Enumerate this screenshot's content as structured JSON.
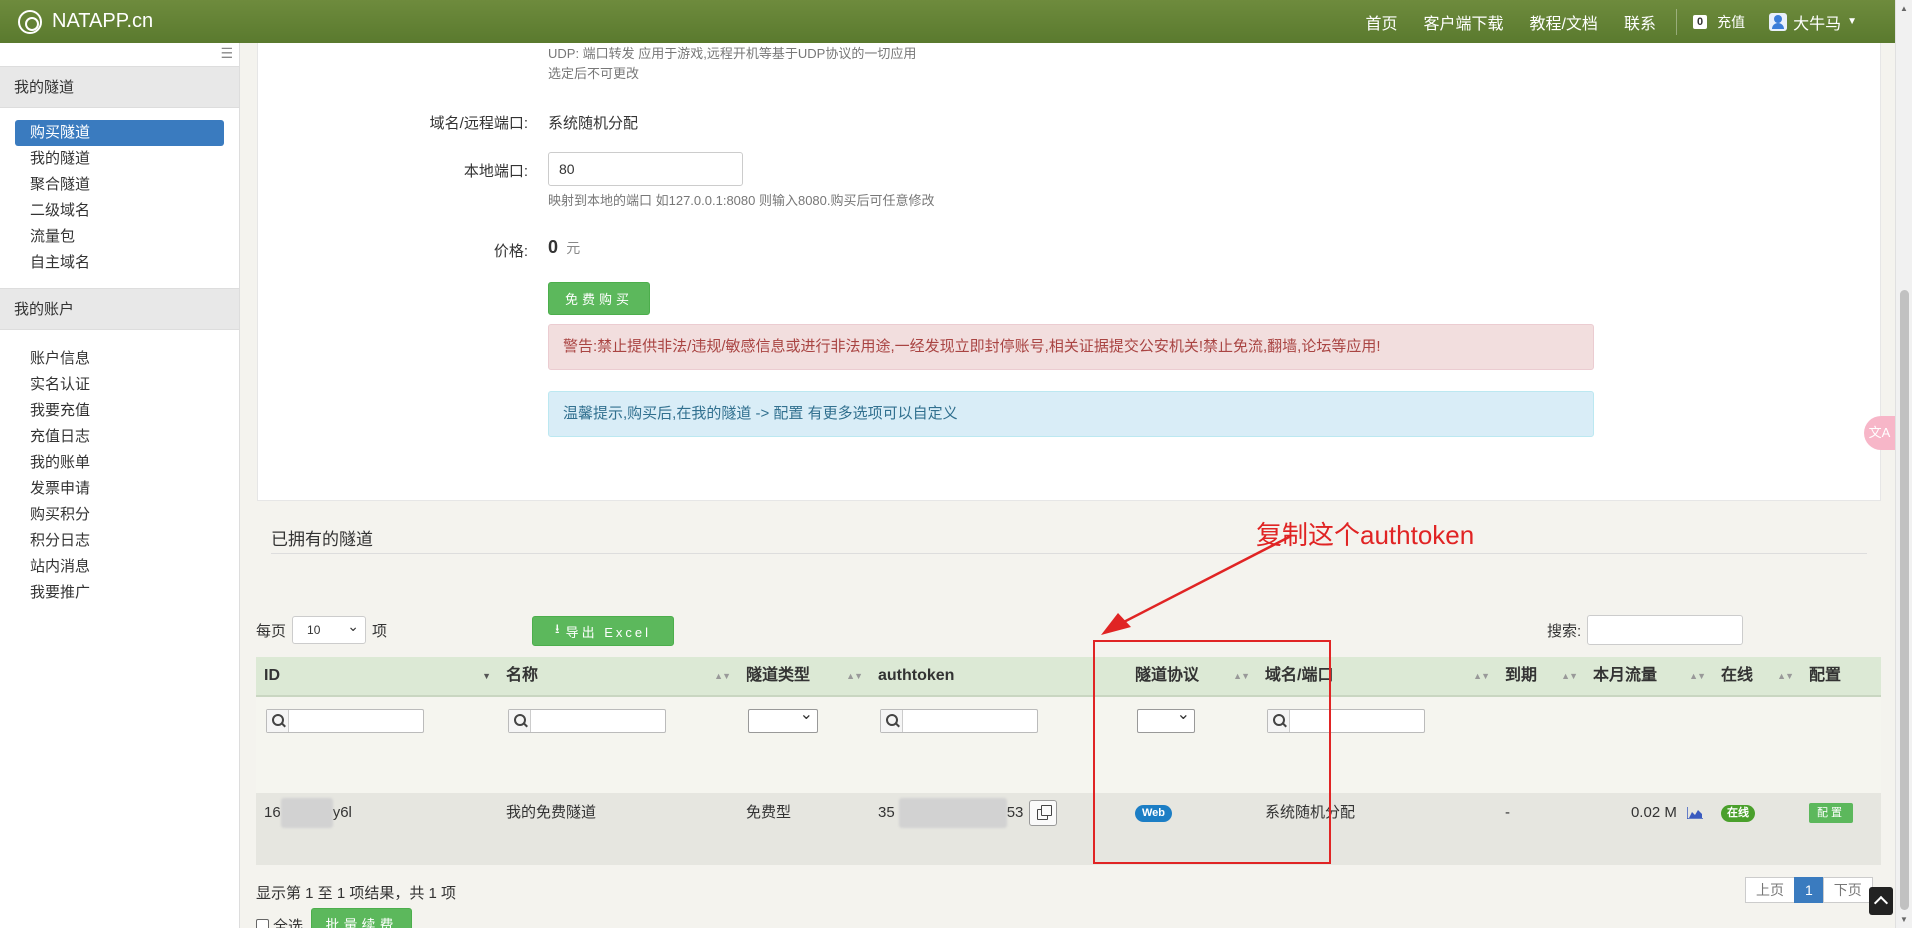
{
  "header": {
    "brand": "NATAPP.cn",
    "nav": [
      "首页",
      "客户端下载",
      "教程/文档",
      "联系"
    ],
    "balance": "0",
    "recharge": "充值",
    "user": "大牛马"
  },
  "sidebar": {
    "tunnels_title": "我的隧道",
    "tunnel_items": [
      "购买隧道",
      "我的隧道",
      "聚合隧道",
      "二级域名",
      "流量包",
      "自主域名"
    ],
    "account_title": "我的账户",
    "account_items": [
      "账户信息",
      "实名认证",
      "我要充值",
      "充值日志",
      "我的账单",
      "发票申请",
      "购买积分",
      "积分日志",
      "站内消息",
      "我要推广"
    ]
  },
  "form": {
    "udp_hint": "UDP: 端口转发 应用于游戏,远程开机等基于UDP协议的一切应用",
    "lock_hint": "选定后不可更改",
    "domain_label": "域名/远程端口:",
    "domain_value": "系统随机分配",
    "local_port_label": "本地端口:",
    "local_port_value": "80",
    "local_port_hint": "映射到本地的端口 如127.0.0.1:8080 则输入8080.购买后可任意修改",
    "price_label": "价格:",
    "price_value": "0",
    "price_unit": "元",
    "buy_button": "免费购买",
    "warning": "警告:禁止提供非法/违规/敏感信息或进行非法用途,一经发现立即封停账号,相关证据提交公安机关!禁止免流,翻墙,论坛等应用!",
    "tip": "温馨提示,购买后,在我的隧道 -> 配置 有更多选项可以自定义"
  },
  "list": {
    "title": "已拥有的隧道",
    "annotation": "复制这个authtoken",
    "per_page_prefix": "每页",
    "per_page_value": "10",
    "per_page_suffix": "项",
    "export_button": "导出 Excel",
    "search_label": "搜索:",
    "columns": [
      "ID",
      "名称",
      "隧道类型",
      "authtoken",
      "隧道协议",
      "域名/端口",
      "到期",
      "本月流量",
      "在线",
      "配置"
    ],
    "row": {
      "id_prefix": "16",
      "id_suffix": "y6l",
      "name": "我的免费隧道",
      "type": "免费型",
      "token_prefix": "35",
      "token_suffix": "53",
      "protocol": "Web",
      "domain": "系统随机分配",
      "expire": "-",
      "traffic": "0.02 M",
      "online": "在线",
      "config": "配置"
    },
    "summary": "显示第 1 至 1 项结果，共 1 项",
    "pager": [
      "上页",
      "1",
      "下页"
    ],
    "select_all": "全选",
    "renew_button": "批量续费"
  },
  "colors": {
    "topbar": "#6e8b3d",
    "primary": "#3a7bbf",
    "success": "#5cb85c",
    "annotation": "#e02424"
  }
}
